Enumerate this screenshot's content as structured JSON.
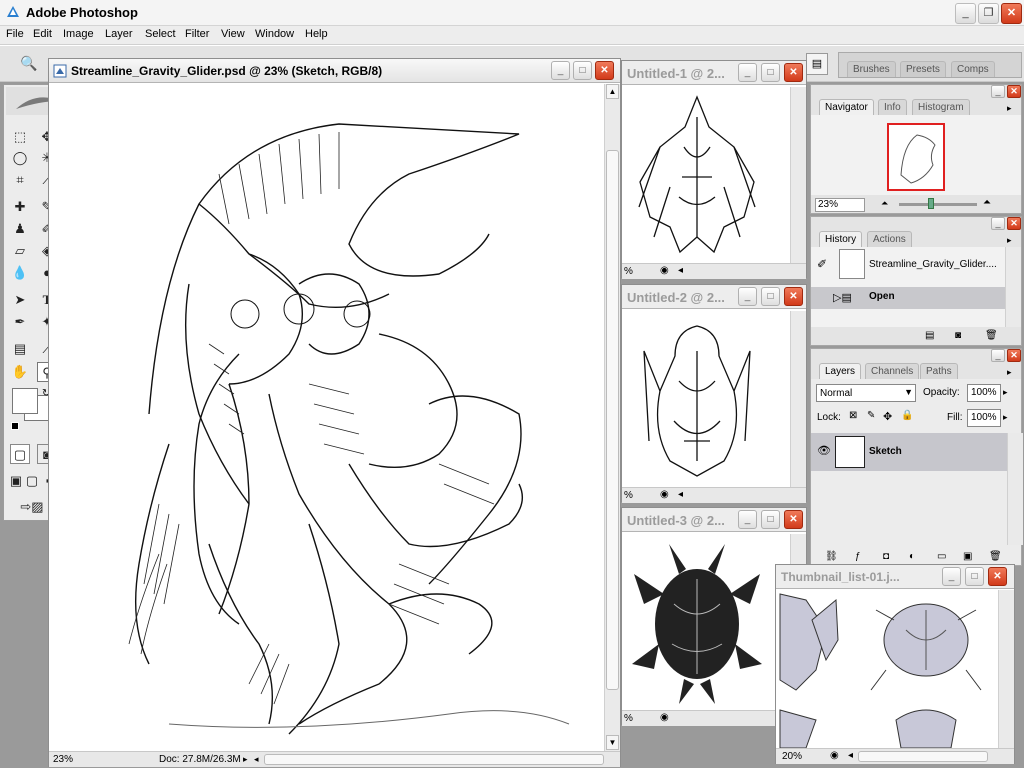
{
  "app": {
    "title": "Adobe Photoshop"
  },
  "menu": [
    "File",
    "Edit",
    "Image",
    "Layer",
    "Select",
    "Filter",
    "View",
    "Window",
    "Help"
  ],
  "palette_well": {
    "tabs": [
      "Brushes",
      "Presets",
      "Comps"
    ]
  },
  "main_doc": {
    "title": "Streamline_Gravity_Glider.psd @ 23% (Sketch, RGB/8)",
    "zoom": "23%",
    "doc_size": "Doc: 27.8M/26.3M"
  },
  "side_docs": [
    {
      "title": "Untitled-1 @ 2...",
      "zoom": "%"
    },
    {
      "title": "Untitled-2 @ 2...",
      "zoom": "%"
    },
    {
      "title": "Untitled-3 @ 2...",
      "zoom": "%"
    }
  ],
  "thumb_doc": {
    "title": "Thumbnail_list-01.j...",
    "zoom": "20%"
  },
  "navigator": {
    "tabs": [
      "Navigator",
      "Info",
      "Histogram"
    ],
    "zoom": "23%"
  },
  "history": {
    "tabs": [
      "History",
      "Actions"
    ],
    "snapshot": "Streamline_Gravity_Glider....",
    "state": "Open"
  },
  "layers": {
    "tabs": [
      "Layers",
      "Channels",
      "Paths"
    ],
    "blend_mode": "Normal",
    "opacity_label": "Opacity:",
    "opacity": "100%",
    "lock_label": "Lock:",
    "fill_label": "Fill:",
    "fill": "100%",
    "layer_name": "Sketch"
  }
}
